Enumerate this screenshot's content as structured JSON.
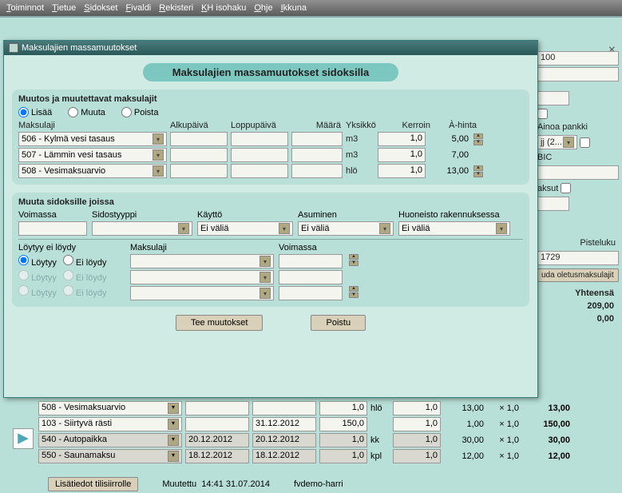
{
  "menu": [
    "Toiminnot",
    "Tietue",
    "Sidokset",
    "Fivaldi",
    "Rekisteri",
    "KH isohaku",
    "Ohje",
    "Ikkuna"
  ],
  "dialog": {
    "window_title": "Maksulajien massamuutokset",
    "header": "Maksulajien massamuutokset sidoksilla",
    "section1": {
      "title": "Muutos ja muutettavat maksulajit",
      "radios": {
        "lisaa": "Lisää",
        "muuta": "Muuta",
        "poista": "Poista"
      },
      "cols": {
        "maksulaji": "Maksulaji",
        "alku": "Alkupäivä",
        "loppu": "Loppupäivä",
        "maara": "Määrä",
        "yksikko": "Yksikkö",
        "kerroin": "Kerroin",
        "hinta": "À-hinta"
      },
      "rows": [
        {
          "maksulaji": "506 - Kylmä vesi tasaus",
          "alku": "",
          "loppu": "",
          "maara": "",
          "yks": "m3",
          "kerroin": "1,0",
          "hinta": "5,00"
        },
        {
          "maksulaji": "507 - Lämmin vesi tasaus",
          "alku": "",
          "loppu": "",
          "maara": "",
          "yks": "m3",
          "kerroin": "1,0",
          "hinta": "7,00"
        },
        {
          "maksulaji": "508 - Vesimaksuarvio",
          "alku": "",
          "loppu": "",
          "maara": "",
          "yks": "hlö",
          "kerroin": "1,0",
          "hinta": "13,00"
        }
      ]
    },
    "section2": {
      "title": "Muuta sidoksille joissa",
      "labels": {
        "voimassa": "Voimassa",
        "sidostyyppi": "Sidostyyppi",
        "kaytto": "Käyttö",
        "asuminen": "Asuminen",
        "huoneisto": "Huoneisto rakennuksessa"
      },
      "ei_valia": "Ei väliä",
      "loytyy_title": "Löytyy ei löydy",
      "maksulaji_lbl": "Maksulaji",
      "voimassa_lbl": "Voimassa",
      "radios": {
        "loytyy": "Löytyy",
        "eiloydy": "Ei löydy"
      }
    },
    "buttons": {
      "tee": "Tee muutokset",
      "poistu": "Poistu"
    }
  },
  "bg": {
    "val100": "100",
    "ainoa": "Ainoa pankki",
    "jcombo": "jj (2...",
    "bic": "BIC",
    "aksut": "aksut",
    "piste_lbl": "Pisteluku",
    "piste_val": "1729",
    "oletus": "uda oletusmaksulajit",
    "yht": "Yhteensä",
    "sum1": "209,00",
    "sum2": "0,00"
  },
  "bottom": {
    "rows": [
      {
        "name": "508 - Vesimaksuarvio",
        "d1": "",
        "d2": "",
        "m": "1,0",
        "yks": "hlö",
        "k": "1,0",
        "h": "13,00",
        "x": "× 1,0",
        "t": "13,00",
        "dark": false
      },
      {
        "name": "103 - Siirtyvä rästi",
        "d1": "",
        "d2": "31.12.2012",
        "m": "150,0",
        "yks": "",
        "k": "1,0",
        "h": "1,00",
        "x": "× 1,0",
        "t": "150,00",
        "dark": false
      },
      {
        "name": "540 - Autopaikka",
        "d1": "20.12.2012",
        "d2": "20.12.2012",
        "m": "1,0",
        "yks": "kk",
        "k": "1,0",
        "h": "30,00",
        "x": "× 1,0",
        "t": "30,00",
        "dark": true
      },
      {
        "name": "550 - Saunamaksu",
        "d1": "18.12.2012",
        "d2": "18.12.2012",
        "m": "1,0",
        "yks": "kpl",
        "k": "1,0",
        "h": "12,00",
        "x": "× 1,0",
        "t": "12,00",
        "dark": true
      }
    ],
    "lisatiedot": "Lisätiedot tilisiirrolle",
    "muutettu_lbl": "Muutettu",
    "muutettu_val": "14:41 31.07.2014",
    "user": "fvdemo-harri"
  }
}
